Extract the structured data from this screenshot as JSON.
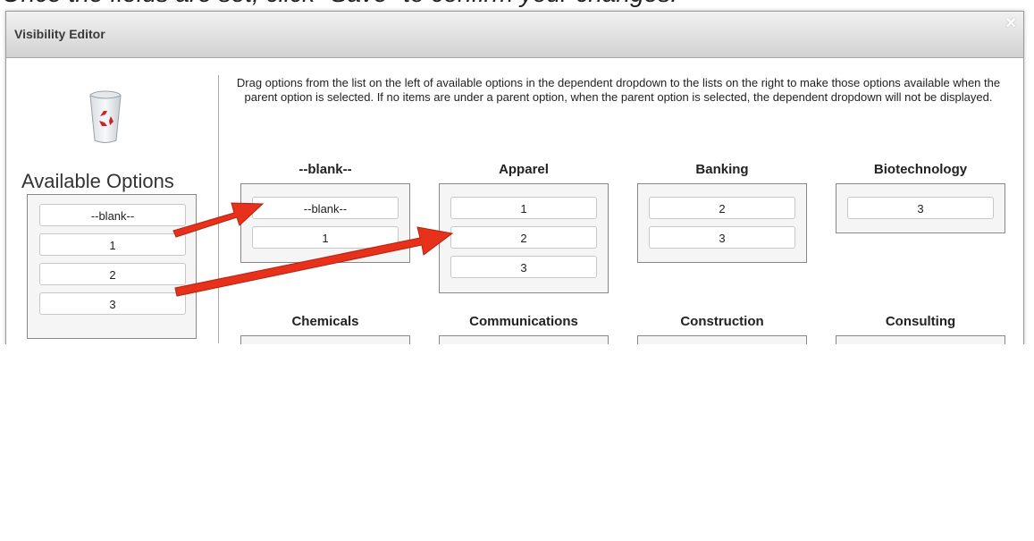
{
  "background_caption": "Once the fields are set, click \"Save\" to confirm your changes.",
  "dialog": {
    "title": "Visibility Editor",
    "close_symbol": "×"
  },
  "trash_icon": "recycle-bin-icon",
  "available": {
    "title": "Available Options",
    "options": [
      "--blank--",
      "1",
      "2",
      "3"
    ]
  },
  "instructions": "Drag options from the list on the left of available options in the dependent dropdown to the lists on the right to make those options available when the parent option is selected. If no items are under a parent option, when the parent option is selected, the dependent dropdown will not be displayed.",
  "groups": [
    {
      "title": "--blank--",
      "options": [
        "--blank--",
        "1"
      ]
    },
    {
      "title": "Apparel",
      "options": [
        "1",
        "2",
        "3"
      ]
    },
    {
      "title": "Banking",
      "options": [
        "2",
        "3"
      ]
    },
    {
      "title": "Biotechnology",
      "options": [
        "3"
      ]
    },
    {
      "title": "Chemicals",
      "options": []
    },
    {
      "title": "Communications",
      "options": []
    },
    {
      "title": "Construction",
      "options": []
    },
    {
      "title": "Consulting",
      "options": []
    }
  ],
  "colors": {
    "arrow": "#e8311a",
    "recycle_symbol": "#d0202a"
  }
}
